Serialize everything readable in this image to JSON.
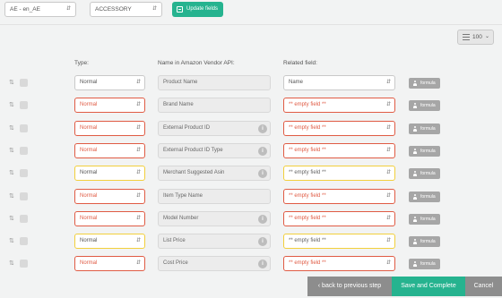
{
  "toolbar": {
    "language": "AE - en_AE",
    "category": "ACCESSORY",
    "update_label": "Update fields",
    "page_size": "100"
  },
  "headers": {
    "type": "Type:",
    "api": "Name in Amazon Vendor API:",
    "related": "Related field:"
  },
  "formula_label": "formula",
  "rows": [
    {
      "type": "Normal",
      "type_state": "normal",
      "api": "Product Name",
      "info": false,
      "related": "Name",
      "related_state": "normal"
    },
    {
      "type": "Normal",
      "type_state": "red",
      "api": "Brand Name",
      "info": false,
      "related": "** empty field **",
      "related_state": "red"
    },
    {
      "type": "Normal",
      "type_state": "red",
      "api": "External Product ID",
      "info": true,
      "related": "** empty field **",
      "related_state": "red"
    },
    {
      "type": "Normal",
      "type_state": "red",
      "api": "External Product ID Type",
      "info": true,
      "related": "** empty field **",
      "related_state": "red"
    },
    {
      "type": "Normal",
      "type_state": "yellow",
      "api": "Merchant Suggested Asin",
      "info": true,
      "related": "** empty field **",
      "related_state": "yellow"
    },
    {
      "type": "Normal",
      "type_state": "red",
      "api": "Item Type Name",
      "info": false,
      "related": "** empty field **",
      "related_state": "red"
    },
    {
      "type": "Normal",
      "type_state": "red",
      "api": "Model Number",
      "info": true,
      "related": "** empty field **",
      "related_state": "red"
    },
    {
      "type": "Normal",
      "type_state": "yellow",
      "api": "List Price",
      "info": true,
      "related": "** empty field **",
      "related_state": "yellow"
    },
    {
      "type": "Normal",
      "type_state": "red",
      "api": "Cost Price",
      "info": true,
      "related": "** empty field **",
      "related_state": "red"
    }
  ],
  "footer": {
    "back_label": "‹ back to previous step",
    "save_label": "Save and Complete",
    "cancel_label": "Cancel"
  },
  "icons": {
    "drag": "sort-arrows-icon",
    "update": "fields-icon",
    "pager": "list-icon",
    "formula": "user-icon",
    "info": "info-icon"
  },
  "colors": {
    "accent": "#26b38f",
    "error": "#e05b44",
    "warning": "#f2cf3c",
    "muted_button": "#8d8d8d"
  }
}
